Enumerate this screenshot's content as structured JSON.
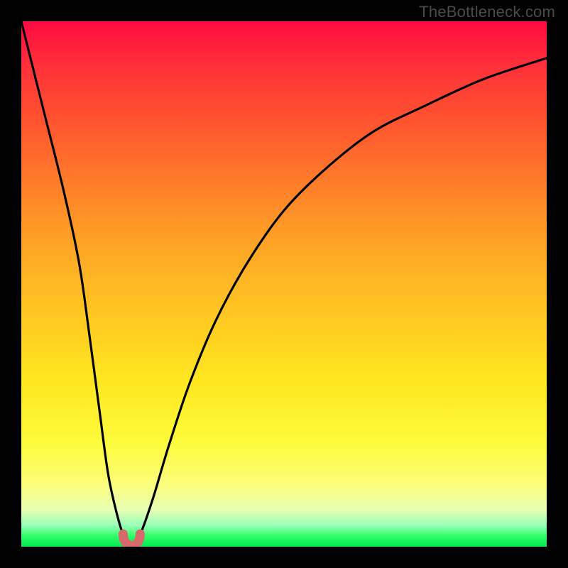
{
  "attribution": "TheBottleneck.com",
  "colors": {
    "frame": "#000000",
    "gradient_stops": [
      {
        "pct": 0,
        "hex": "#ff0a42"
      },
      {
        "pct": 8,
        "hex": "#ff2f3a"
      },
      {
        "pct": 18,
        "hex": "#ff5030"
      },
      {
        "pct": 30,
        "hex": "#ff7a2a"
      },
      {
        "pct": 42,
        "hex": "#ffa326"
      },
      {
        "pct": 55,
        "hex": "#ffc522"
      },
      {
        "pct": 68,
        "hex": "#ffe61f"
      },
      {
        "pct": 80,
        "hex": "#fdfb3a"
      },
      {
        "pct": 88,
        "hex": "#fcfd7a"
      },
      {
        "pct": 93,
        "hex": "#e8ffb5"
      },
      {
        "pct": 96,
        "hex": "#97ffb8"
      },
      {
        "pct": 98,
        "hex": "#2fff66"
      },
      {
        "pct": 100,
        "hex": "#00e851"
      }
    ],
    "curve_stroke": "#000000",
    "marker_fill": "#d56a6a"
  },
  "chart_data": {
    "type": "line",
    "title": "",
    "xlabel": "",
    "ylabel": "",
    "xlim": [
      0,
      100
    ],
    "ylim": [
      0,
      100
    ],
    "series": [
      {
        "name": "bottleneck-curve",
        "x": [
          0,
          4,
          8,
          11,
          13,
          15,
          16.5,
          18,
          19.5,
          21,
          22.5,
          25,
          28,
          32,
          37,
          43,
          50,
          58,
          67,
          77,
          88,
          100
        ],
        "values": [
          100,
          84,
          68,
          54,
          40,
          25,
          14,
          7,
          2,
          0,
          2,
          9,
          19,
          31,
          43,
          54,
          64,
          72,
          79,
          84,
          89,
          93
        ]
      }
    ],
    "marker": {
      "name": "optimal-point",
      "x": 21,
      "y": 0,
      "shape": "u",
      "color": "#d56a6a"
    },
    "background_heat": {
      "axis": "y",
      "low_value_color": "#00e851",
      "high_value_color": "#ff0a42"
    }
  }
}
